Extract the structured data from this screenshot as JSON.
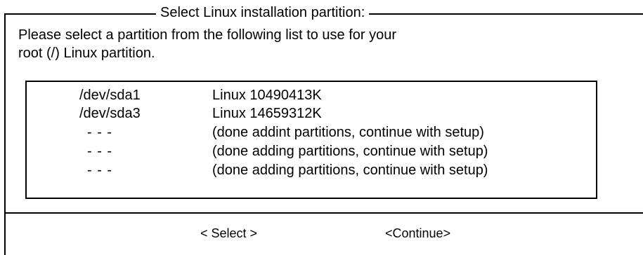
{
  "dialog": {
    "title": "Select Linux installation partition:",
    "prompt_lines": [
      "Please select a partition from the following list to use for your",
      "root (/) Linux partition."
    ]
  },
  "partitions": [
    {
      "device": "/dev/sda1",
      "description": "Linux 10490413K"
    },
    {
      "device": "/dev/sda3",
      "description": "Linux 14659312K"
    },
    {
      "device": "- - -",
      "description": "(done addint partitions, continue with setup)"
    },
    {
      "device": "- - -",
      "description": "(done adding partitions, continue with setup)"
    },
    {
      "device": "- - -",
      "description": "(done adding partitions, continue with setup)"
    }
  ],
  "buttons": {
    "select_label": "< Select >",
    "continue_label": "<Continue>"
  }
}
